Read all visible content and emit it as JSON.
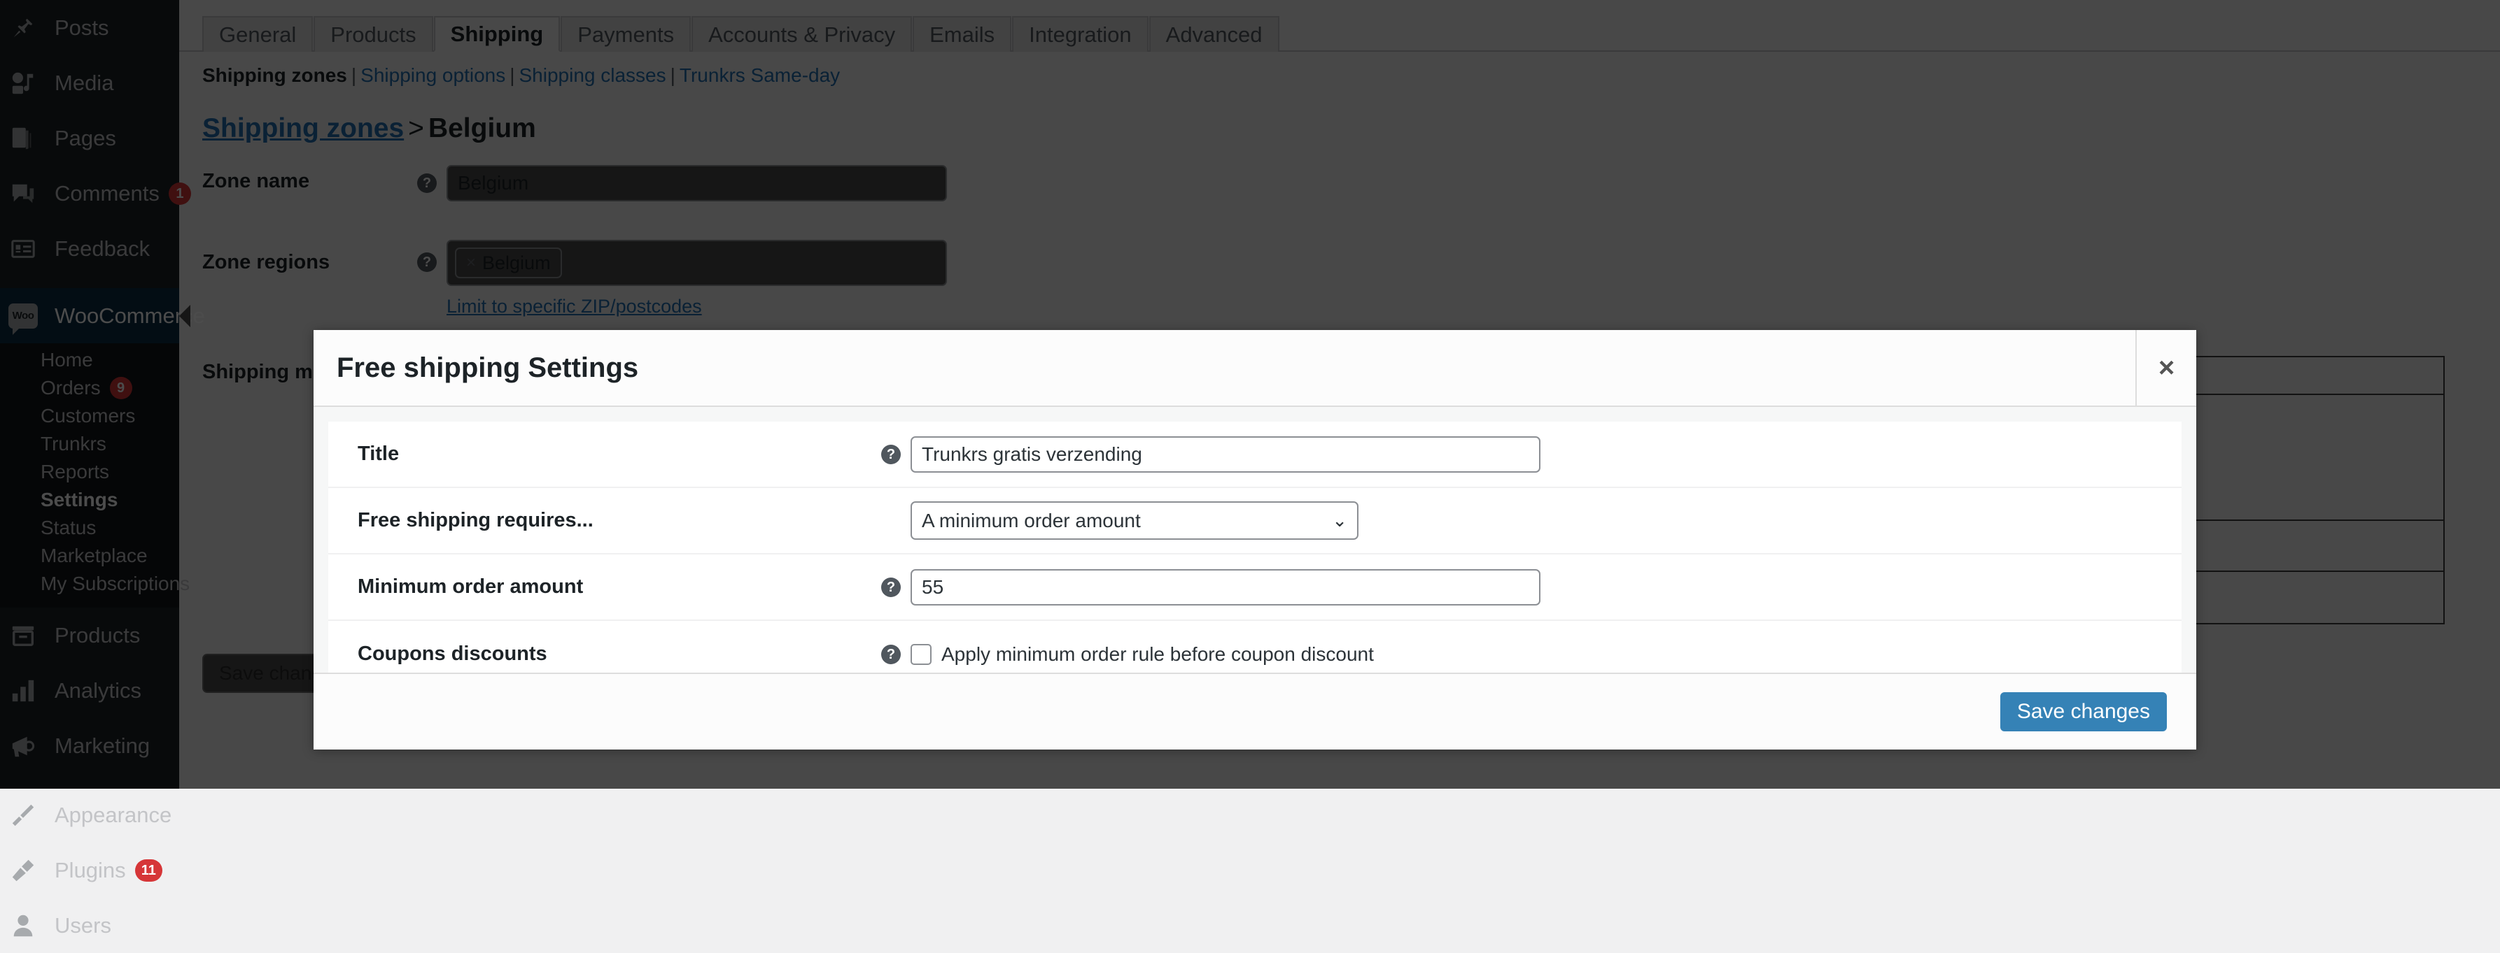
{
  "sidebar": {
    "top_items": [
      {
        "label": "Posts",
        "icon": "pin-icon",
        "badge": null
      },
      {
        "label": "Media",
        "icon": "media-icon",
        "badge": null
      },
      {
        "label": "Pages",
        "icon": "pages-icon",
        "badge": null
      },
      {
        "label": "Comments",
        "icon": "comments-icon",
        "badge": "1"
      },
      {
        "label": "Feedback",
        "icon": "feedback-icon",
        "badge": null
      }
    ],
    "woocommerce": {
      "label": "WooCommerce",
      "icon": "woo-icon",
      "icon_text": "Woo"
    },
    "woocommerce_submenu": [
      {
        "label": "Home",
        "badge": null,
        "current": false
      },
      {
        "label": "Orders",
        "badge": "9",
        "current": false
      },
      {
        "label": "Customers",
        "badge": null,
        "current": false
      },
      {
        "label": "Trunkrs",
        "badge": null,
        "current": false
      },
      {
        "label": "Reports",
        "badge": null,
        "current": false
      },
      {
        "label": "Settings",
        "badge": null,
        "current": true
      },
      {
        "label": "Status",
        "badge": null,
        "current": false
      },
      {
        "label": "Marketplace",
        "badge": null,
        "current": false
      },
      {
        "label": "My Subscriptions",
        "badge": null,
        "current": false
      }
    ],
    "mid_items": [
      {
        "label": "Products",
        "icon": "products-icon",
        "badge": null
      },
      {
        "label": "Analytics",
        "icon": "analytics-icon",
        "badge": null
      },
      {
        "label": "Marketing",
        "icon": "marketing-icon",
        "badge": null
      }
    ],
    "bottom_items": [
      {
        "label": "Appearance",
        "icon": "appearance-icon",
        "badge": null
      },
      {
        "label": "Plugins",
        "icon": "plugins-icon",
        "badge": "11"
      },
      {
        "label": "Users",
        "icon": "users-icon",
        "badge": null
      }
    ]
  },
  "tabs": [
    {
      "label": "General",
      "active": false
    },
    {
      "label": "Products",
      "active": false
    },
    {
      "label": "Shipping",
      "active": true
    },
    {
      "label": "Payments",
      "active": false
    },
    {
      "label": "Accounts & Privacy",
      "active": false
    },
    {
      "label": "Emails",
      "active": false
    },
    {
      "label": "Integration",
      "active": false
    },
    {
      "label": "Advanced",
      "active": false
    }
  ],
  "subnav": [
    {
      "label": "Shipping zones",
      "current": true
    },
    {
      "label": "Shipping options",
      "current": false
    },
    {
      "label": "Shipping classes",
      "current": false
    },
    {
      "label": "Trunkrs Same-day",
      "current": false
    }
  ],
  "breadcrumb": {
    "link": "Shipping zones",
    "separator": ">",
    "current": "Belgium"
  },
  "zone_form": {
    "zone_name_label": "Zone name",
    "zone_name_value": "Belgium",
    "zone_regions_label": "Zone regions",
    "zone_region_chip": "Belgium",
    "zone_region_chip_remove": "×",
    "zip_link": "Limit to specific ZIP/postcodes",
    "shipping_methods_label": "Shipping methods",
    "save_changes_label": "Save changes"
  },
  "modal": {
    "title": "Free shipping Settings",
    "close_label": "×",
    "help_glyph": "?",
    "rows": [
      {
        "label": "Title",
        "type": "text",
        "value": "Trunkrs gratis verzending",
        "has_help": true
      },
      {
        "label": "Free shipping requires...",
        "type": "select",
        "value": "A minimum order amount",
        "chevron": "⌄",
        "has_help": false
      },
      {
        "label": "Minimum order amount",
        "type": "text",
        "value": "55",
        "has_help": true
      },
      {
        "label": "Coupons discounts",
        "type": "checkbox",
        "value": "Apply minimum order rule before coupon discount",
        "checked": false,
        "has_help": true
      }
    ],
    "save_label": "Save changes"
  },
  "colors": {
    "admin_bg": "#1d2327",
    "accent_link": "#2271b1",
    "primary_button": "#3582b6",
    "badge_red": "#d63638",
    "current_menu": "#0a2e45"
  }
}
